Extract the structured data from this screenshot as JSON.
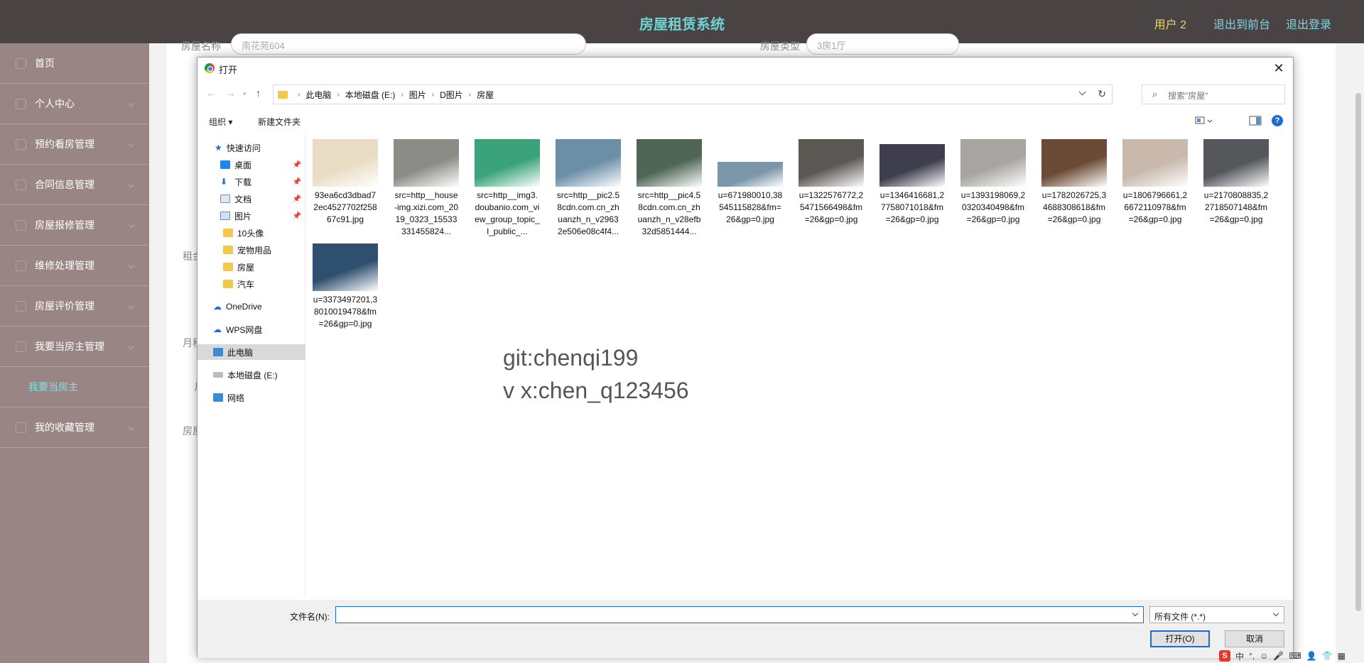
{
  "header": {
    "title": "房屋租赁系统",
    "user": "用户 2",
    "front_link": "退出到前台",
    "logout_link": "退出登录"
  },
  "sidebar": {
    "items": [
      {
        "label": "首页"
      },
      {
        "label": "个人中心"
      },
      {
        "label": "预约看房管理"
      },
      {
        "label": "合同信息管理"
      },
      {
        "label": "房屋报修管理"
      },
      {
        "label": "维修处理管理"
      },
      {
        "label": "房屋评价管理"
      },
      {
        "label": "我要当房主管理"
      }
    ],
    "sub_item": "我要当房主",
    "last_item": "我的收藏管理"
  },
  "form_bg": {
    "house_name_label": "房屋名称",
    "house_name_value": "南花苑604",
    "house_type_label": "房屋类型",
    "house_type_value": "3房1厅",
    "rent_label_partial": "租金",
    "month_label_partial": "月租",
    "month2_label_partial": "月",
    "house_label_partial": "房屋"
  },
  "dialog": {
    "title": "打开",
    "close": "✕",
    "breadcrumb": [
      "此电脑",
      "本地磁盘 (E:)",
      "图片",
      "D图片",
      "房屋"
    ],
    "search_placeholder": "搜索\"房屋\"",
    "toolbar": {
      "organize": "组织 ▾",
      "new_folder": "新建文件夹"
    },
    "nav_pane": {
      "quick_access": "快速访问",
      "desktop": "桌面",
      "downloads": "下载",
      "documents": "文档",
      "pictures": "图片",
      "folder1": "10头像",
      "folder2": "宠物用品",
      "folder3": "房屋",
      "folder4": "汽车",
      "onedrive": "OneDrive",
      "wps": "WPS网盘",
      "this_pc": "此电脑",
      "local_disk": "本地磁盘 (E:)",
      "network": "网络"
    },
    "files": [
      {
        "name": "93ea6cd3dbad72ec4527702f25867c91.jpg",
        "color": "#e8dcc4"
      },
      {
        "name": "src=http__house-img.xizi.com_2019_0323_15533331455824...",
        "color": "#8c8c86"
      },
      {
        "name": "src=http__img3.doubanio.com_view_group_topic_l_public_...",
        "color": "#3aa37a"
      },
      {
        "name": "src=http__pic2.58cdn.com.cn_zhuanzh_n_v29632e506e08c4f4...",
        "color": "#6c8fa8"
      },
      {
        "name": "src=http__pic4.58cdn.com.cn_zhuanzh_n_v28efb32d5851444...",
        "color": "#4f6657"
      },
      {
        "name": "u=671980010,38545115828&fm=26&gp=0.jpg",
        "color": "#7b96a8"
      },
      {
        "name": "u=1322576772,25471566498&fm=26&gp=0.jpg",
        "color": "#5b5753"
      },
      {
        "name": "u=1346416681,27758071018&fm=26&gp=0.jpg",
        "color": "#3f3e4e"
      },
      {
        "name": "u=1393198069,20320340498&fm=26&gp=0.jpg",
        "color": "#a7a59f"
      },
      {
        "name": "u=1782026725,34688308618&fm=26&gp=0.jpg",
        "color": "#6b4a36"
      },
      {
        "name": "u=1806796661,26672110978&fm=26&gp=0.jpg",
        "color": "#c8b9ac"
      },
      {
        "name": "u=2170808835,22718507148&fm=26&gp=0.jpg",
        "color": "#55575c"
      },
      {
        "name": "u=3373497201,38010019478&fm=26&gp=0.jpg",
        "color": "#2f4f6e"
      }
    ],
    "watermark_line1": "git:chenqi199",
    "watermark_line2": "v x:chen_q123456",
    "filename_label": "文件名(N):",
    "filename_value": "",
    "filter": "所有文件 (*.*)",
    "open_button": "打开(O)",
    "cancel_button": "取消"
  },
  "ime": {
    "s": "S",
    "lang": "中",
    "punct": "°,"
  }
}
